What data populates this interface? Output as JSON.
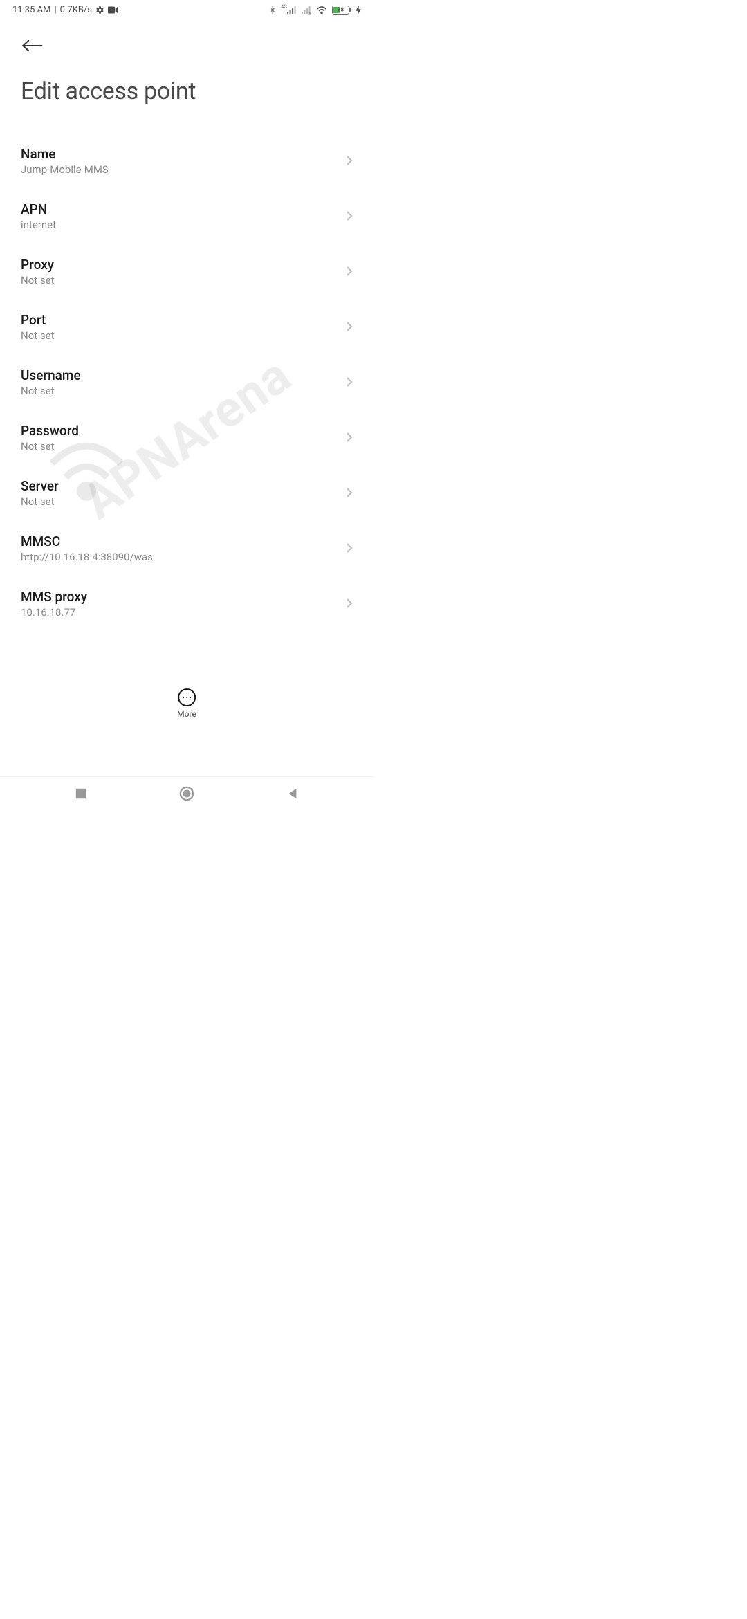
{
  "status": {
    "time": "11:35 AM",
    "data_rate": "0.7KB/s",
    "network_label": "4G",
    "battery_pct": "38"
  },
  "header": {
    "title": "Edit access point"
  },
  "settings": [
    {
      "label": "Name",
      "value": "Jump-Mobile-MMS"
    },
    {
      "label": "APN",
      "value": "internet"
    },
    {
      "label": "Proxy",
      "value": "Not set"
    },
    {
      "label": "Port",
      "value": "Not set"
    },
    {
      "label": "Username",
      "value": "Not set"
    },
    {
      "label": "Password",
      "value": "Not set"
    },
    {
      "label": "Server",
      "value": "Not set"
    },
    {
      "label": "MMSC",
      "value": "http://10.16.18.4:38090/was"
    },
    {
      "label": "MMS proxy",
      "value": "10.16.18.77"
    }
  ],
  "floating": {
    "more_label": "More"
  },
  "watermark": {
    "text": "APNArena"
  }
}
